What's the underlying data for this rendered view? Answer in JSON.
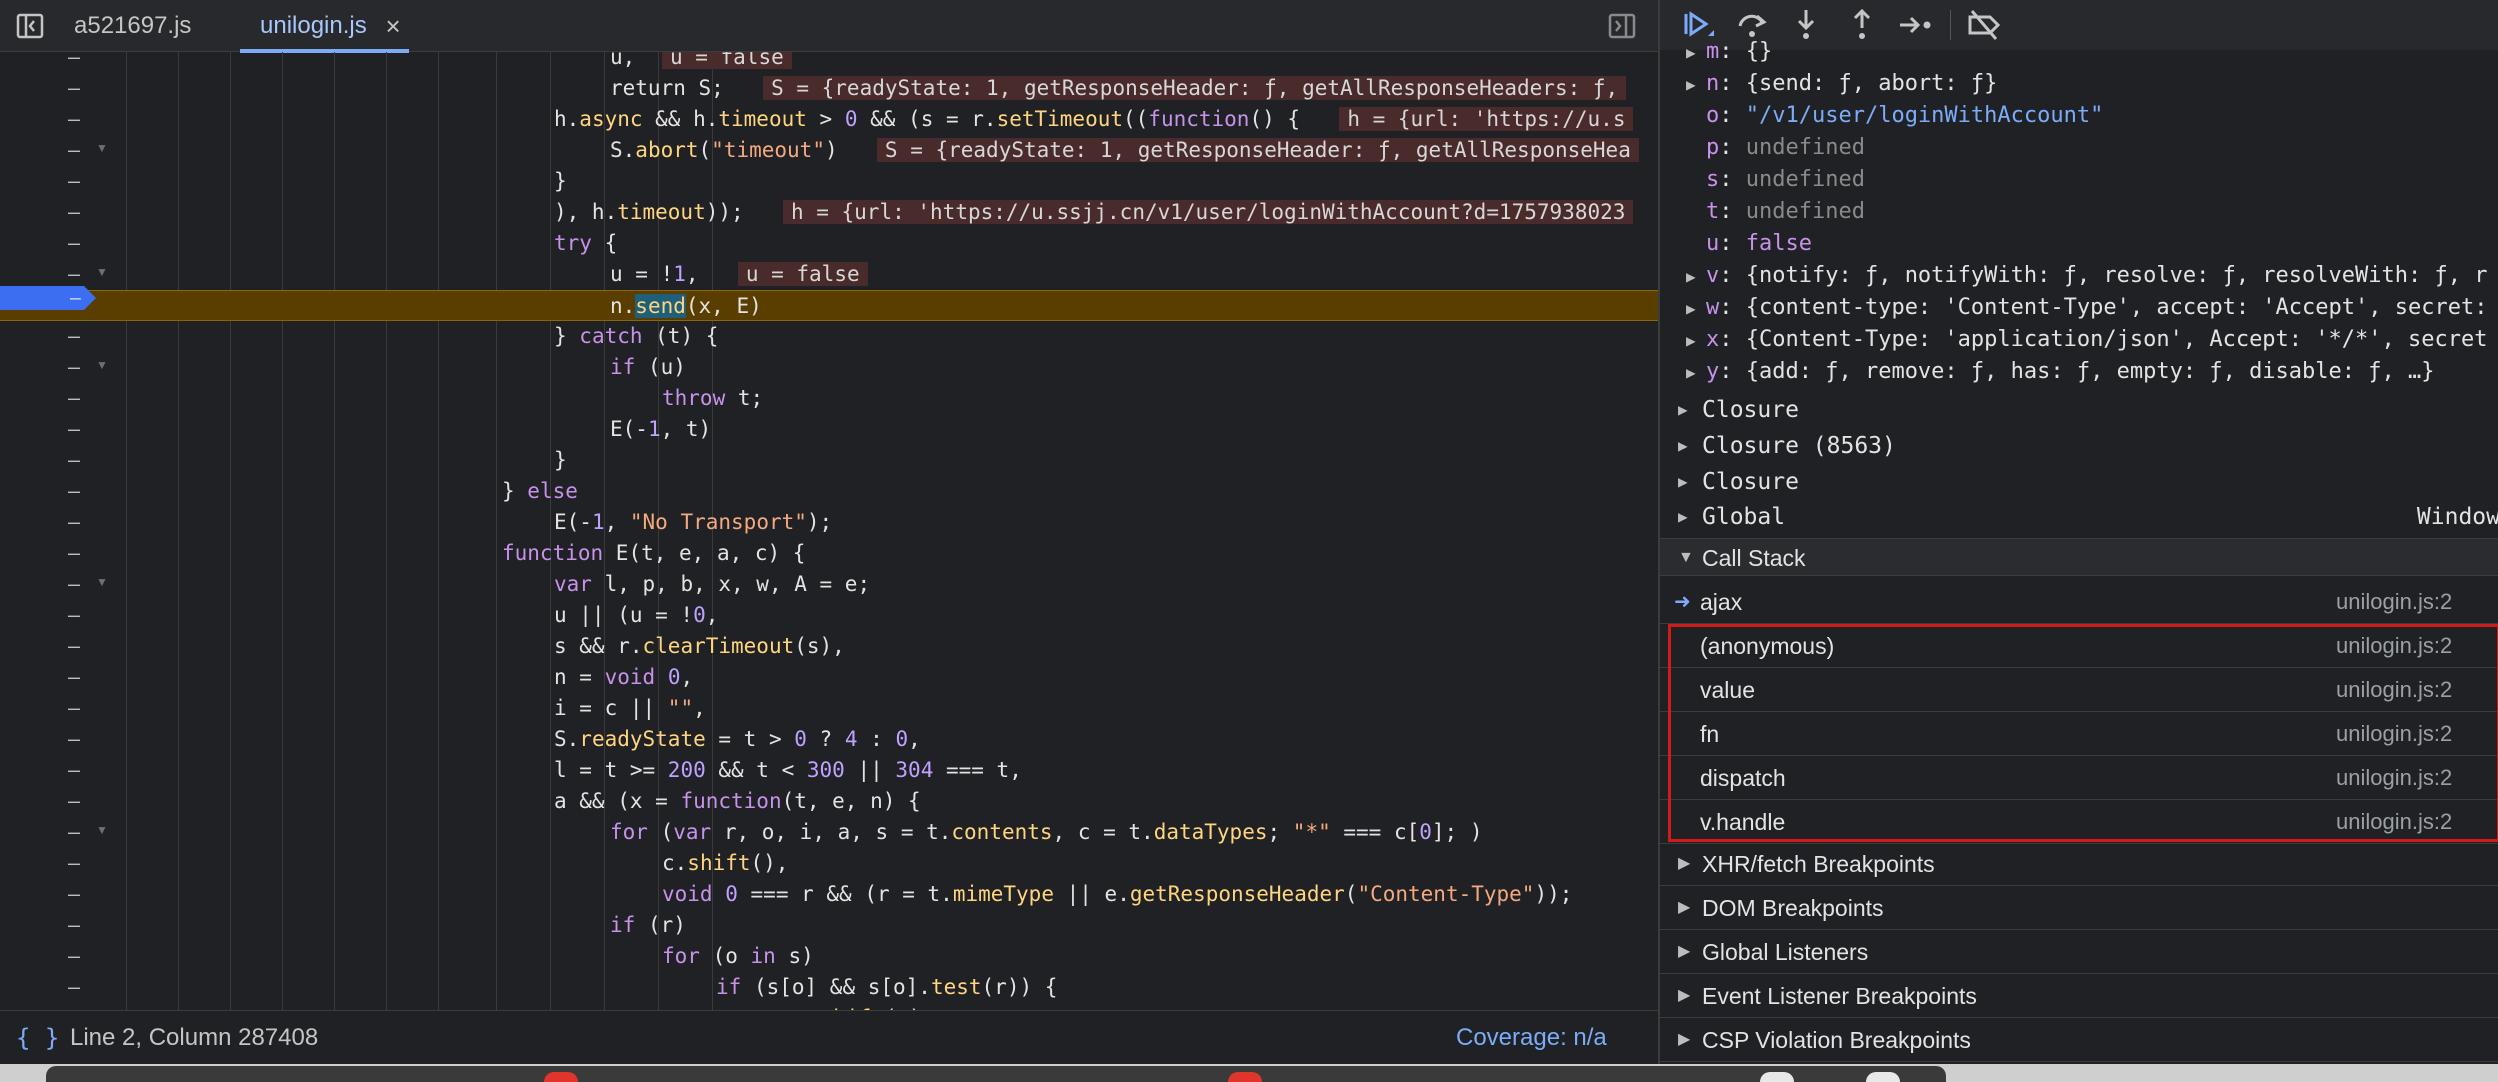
{
  "editor": {
    "tabs": [
      {
        "label": "a521697.js"
      },
      {
        "label": "unilogin.js",
        "close": "×"
      }
    ],
    "code_lines": [
      {
        "html": "u, <span class=\"inline\">u = false</span>"
      },
      {
        "html": "return S;  <span class=\"inline\">S = {readyState: 1, getResponseHeader: ƒ, getAllResponseHeaders: ƒ,</span>"
      },
      {
        "html": "h.<span class=\"prop\">async</span> &amp;&amp; h.<span class=\"prop\">timeout</span> &gt; <span class=\"num\">0</span> &amp;&amp; (s = r.<span class=\"fn\">setTimeout</span>((<span class=\"kw\">function</span>() {  <span class=\"inline\">h = {url: 'https://u.s</span>"
      },
      {
        "html": "S.<span class=\"fn\">abort</span>(<span class=\"str\">\"timeout\"</span>)  <span class=\"inline\">S = {readyState: 1, getResponseHeader: ƒ, getAllResponseHea</span>"
      },
      {
        "html": "}"
      },
      {
        "html": "), h.<span class=\"prop\">timeout</span>));  <span class=\"inline\">h = {url: 'https://u.ssjj.cn/v1/user/loginWithAccount?d=1757938023</span>"
      },
      {
        "html": "<span class=\"kw\">try</span> {"
      },
      {
        "html": "u = !<span class=\"num\">1</span>,  <span class=\"inline\">u = false</span>"
      },
      {
        "html": "n.<span class=\"sel\">send</span>(x, E)"
      },
      {
        "html": "} <span class=\"kw\">catch</span> (t) {"
      },
      {
        "html": "<span class=\"kw\">if</span> (u)"
      },
      {
        "html": "<span class=\"kw\">throw</span> t;"
      },
      {
        "html": "E(-<span class=\"num\">1</span>, t)"
      },
      {
        "html": "}"
      },
      {
        "html": "} <span class=\"kw\">else</span>"
      },
      {
        "html": "E(-<span class=\"num\">1</span>, <span class=\"str\">\"No Transport\"</span>);"
      },
      {
        "html": "<span class=\"kw\">function</span> E(t, e, a, c) {"
      },
      {
        "html": "<span class=\"kw\">var</span> l, p, b, x, w, A = e;"
      },
      {
        "html": "u || (u = !<span class=\"num\">0</span>,"
      },
      {
        "html": "s &amp;&amp; r.<span class=\"fn\">clearTimeout</span>(s),"
      },
      {
        "html": "n = <span class=\"kw\">void</span> <span class=\"num\">0</span>,"
      },
      {
        "html": "i = c || <span class=\"str\">\"\"</span>,"
      },
      {
        "html": "S.<span class=\"prop\">readyState</span> = t &gt; <span class=\"num\">0</span> ? <span class=\"num\">4</span> : <span class=\"num\">0</span>,"
      },
      {
        "html": "l = t &gt;= <span class=\"num\">200</span> &amp;&amp; t &lt; <span class=\"num\">300</span> || <span class=\"num\">304</span> === t,"
      },
      {
        "html": "a &amp;&amp; (x = <span class=\"kw\">function</span>(t, e, n) {"
      },
      {
        "html": "<span class=\"kw\">for</span> (<span class=\"kw\">var</span> r, o, i, a, s = t.<span class=\"prop\">contents</span>, c = t.<span class=\"prop\">dataTypes</span>; <span class=\"str\">\"*\"</span> === c[<span class=\"num\">0</span>]; )"
      },
      {
        "html": "c.<span class=\"fn\">shift</span>(),"
      },
      {
        "html": "<span class=\"kw\">void</span> <span class=\"num\">0</span> === r &amp;&amp; (r = t.<span class=\"prop\">mimeType</span> || e.<span class=\"fn\">getResponseHeader</span>(<span class=\"str\">\"Content-Type\"</span>));"
      },
      {
        "html": "<span class=\"kw\">if</span> (r)"
      },
      {
        "html": "<span class=\"kw\">for</span> (o <span class=\"kw\">in</span> s)"
      },
      {
        "html": "<span class=\"kw\">if</span> (s[o] &amp;&amp; s[o].<span class=\"fn\">test</span>(r)) {"
      },
      {
        "html": "c.<span class=\"fn\">unshift</span>(o);"
      }
    ],
    "gutter_symbol": "–",
    "status": {
      "pretty_print": "{ }",
      "cursor": "Line 2, Column 287408",
      "coverage": "Coverage: n/a"
    }
  },
  "scope": {
    "lines": [
      {
        "key": "m",
        "val": "{}",
        "cls": "sv-plain",
        "expandable": true
      },
      {
        "key": "n",
        "val": "{send: ƒ, abort: ƒ}",
        "cls": "sv-plain",
        "expandable": true
      },
      {
        "key": "o",
        "val": "\"/v1/user/loginWithAccount\"",
        "cls": "sv-str",
        "expandable": false
      },
      {
        "key": "p",
        "val": "undefined",
        "cls": "sv-undef",
        "expandable": false
      },
      {
        "key": "s",
        "val": "undefined",
        "cls": "sv-undef",
        "expandable": false
      },
      {
        "key": "t",
        "val": "undefined",
        "cls": "sv-undef",
        "expandable": false
      },
      {
        "key": "u",
        "val": "false",
        "cls": "sv-kw",
        "expandable": false
      },
      {
        "key": "v",
        "val": "{notify: ƒ, notifyWith: ƒ, resolve: ƒ, resolveWith: ƒ, r",
        "cls": "sv-plain",
        "expandable": true
      },
      {
        "key": "w",
        "val": "{content-type: 'Content-Type', accept: 'Accept', secret:",
        "cls": "sv-plain",
        "expandable": true
      },
      {
        "key": "x",
        "val": "{Content-Type: 'application/json', Accept: '*/*', secret",
        "cls": "sv-plain",
        "expandable": true
      },
      {
        "key": "y",
        "val": "{add: ƒ, remove: ƒ, has: ƒ, empty: ƒ, disable: ƒ, …}",
        "cls": "sv-plain",
        "expandable": true
      }
    ],
    "sections": [
      {
        "label": "Closure",
        "value": ""
      },
      {
        "label": "Closure (8563)",
        "value": ""
      },
      {
        "label": "Closure",
        "value": ""
      },
      {
        "label": "Global",
        "value": "Window"
      }
    ]
  },
  "callstack": {
    "title": "Call Stack",
    "frames": [
      {
        "name": "ajax",
        "location": "unilogin.js:2",
        "current": true
      },
      {
        "name": "(anonymous)",
        "location": "unilogin.js:2",
        "current": false
      },
      {
        "name": "value",
        "location": "unilogin.js:2",
        "current": false
      },
      {
        "name": "fn",
        "location": "unilogin.js:2",
        "current": false
      },
      {
        "name": "dispatch",
        "location": "unilogin.js:2",
        "current": false
      },
      {
        "name": "v.handle",
        "location": "unilogin.js:2",
        "current": false
      }
    ]
  },
  "breakpoint_sections": [
    {
      "label": "XHR/fetch Breakpoints"
    },
    {
      "label": "DOM Breakpoints"
    },
    {
      "label": "Global Listeners"
    },
    {
      "label": "Event Listener Breakpoints"
    },
    {
      "label": "CSP Violation Breakpoints"
    }
  ],
  "colors": {
    "accent": "#7cacf8",
    "paused_line": "#5a3e00",
    "highlight_box": "#d11a1a",
    "dock_icon_red": "#e0352b"
  },
  "icons": {
    "toolbar": [
      "resume-icon",
      "step-over-icon",
      "step-into-icon",
      "step-out-icon",
      "step-icon",
      "deactivate-breakpoints-icon"
    ]
  }
}
